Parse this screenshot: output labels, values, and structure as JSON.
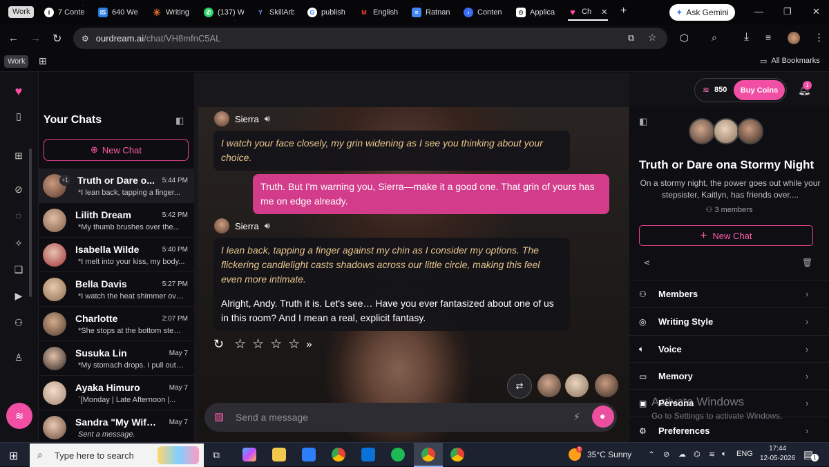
{
  "browser": {
    "tabs": [
      {
        "label": "Work",
        "icon": "work-profile-icon",
        "color": "#dcdcdc"
      },
      {
        "label": "7 Conte",
        "icon": "info-icon",
        "color": "#ffffff"
      },
      {
        "label": "640 We",
        "icon": "is-icon",
        "color": "#2a7de1"
      },
      {
        "label": "Writing",
        "icon": "asterisk-icon",
        "color": "#e56a2b"
      },
      {
        "label": "(137) W",
        "icon": "whatsapp-icon",
        "color": "#25d366"
      },
      {
        "label": "SkillArb",
        "icon": "y-icon",
        "color": "#3a6df0"
      },
      {
        "label": "publish",
        "icon": "google-icon",
        "color": "#ffffff"
      },
      {
        "label": "English",
        "icon": "gmail-icon",
        "color": "#ea4335"
      },
      {
        "label": "Ratnan",
        "icon": "docs-icon",
        "color": "#4285f4"
      },
      {
        "label": "Conten",
        "icon": "content-icon",
        "color": "#3b6cf6"
      },
      {
        "label": "Applica",
        "icon": "apps-icon",
        "color": "#ffffff"
      },
      {
        "label": "Ch",
        "icon": "heart-icon",
        "color": "#ff4fa3"
      }
    ],
    "gemini_label": "Ask Gemini",
    "url_host": "ourdream.ai",
    "url_path": "/chat/VH8mfnC5AL",
    "work_badge": "Work",
    "all_bookmarks": "All Bookmarks"
  },
  "app": {
    "accent": "#f04fa3",
    "coins": "850",
    "buy_coins": "Buy Coins",
    "notifications": "1"
  },
  "chat_list": {
    "heading": "Your Chats",
    "new_chat": "New Chat",
    "chats": [
      {
        "name": "Truth or Dare o...",
        "time": "5:44 PM",
        "preview": "*I lean back, tapping a finger...",
        "badge": "+1"
      },
      {
        "name": "Lilith Dream",
        "time": "5:42 PM",
        "preview": "*My thumb brushes over the..."
      },
      {
        "name": "Isabella Wilde",
        "time": "5:40 PM",
        "preview": "*I melt into your kiss, my body..."
      },
      {
        "name": "Bella Davis",
        "time": "5:27 PM",
        "preview": "*I watch the heat shimmer over..."
      },
      {
        "name": "Charlotte",
        "time": "2:07 PM",
        "preview": "*She stops at the bottom step,..."
      },
      {
        "name": "Susuka Lin",
        "time": "May 7",
        "preview": "*My stomach drops. I pull out m..."
      },
      {
        "name": "Ayaka Himuro",
        "time": "May 7",
        "preview": "`[Monday | Late Afternoon |..."
      },
      {
        "name": "Sandra \"My Wife, ...",
        "time": "May 7",
        "preview": "Sent a message."
      }
    ]
  },
  "conversation": {
    "messages": [
      {
        "speaker": "Sierra",
        "action": "I watch your face closely, my grin widening as I see you thinking about your choice."
      },
      {
        "user": "Truth. But I'm warning you, Sierra—make it a good one. That grin of yours has me on edge already."
      },
      {
        "speaker": "Sierra",
        "action": "I lean back, tapping a finger against my chin as I consider my options. The flickering candlelight casts shadows across our little circle, making this feel even more intimate.",
        "text": "Alright, Andy. Truth it is. Let's see… Have you ever fantasized about one of us in this room? And I mean a real, explicit fantasy."
      }
    ],
    "input_placeholder": "Send a message"
  },
  "details": {
    "title": "Truth or Dare ona Stormy Night",
    "description": "On a stormy night, the power goes out while your stepsister, Kaitlyn, has friends over....",
    "members_count": "3 members",
    "new_chat": "New Chat",
    "menu": [
      {
        "label": "Members",
        "icon": "members-icon"
      },
      {
        "label": "Writing Style",
        "icon": "writing-style-icon"
      },
      {
        "label": "Voice",
        "icon": "speaker-icon"
      },
      {
        "label": "Memory",
        "icon": "book-icon"
      },
      {
        "label": "Persona",
        "icon": "persona-icon"
      },
      {
        "label": "Preferences",
        "icon": "gear-icon"
      }
    ]
  },
  "watermark": {
    "line1": "Activate Windows",
    "line2": "Go to Settings to activate Windows."
  },
  "taskbar": {
    "search": "Type here to search",
    "weather": "35°C  Sunny",
    "weather_badge": "3",
    "lang": "ENG",
    "time": "17:44",
    "date": "12-05-2026",
    "notif": "1"
  }
}
